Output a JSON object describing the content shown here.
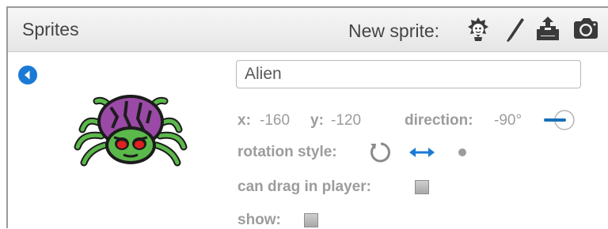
{
  "panel": {
    "title": "Sprites",
    "new_sprite_label": "New sprite:",
    "new_sprite_buttons": [
      "sprite-library-icon",
      "paint-brush-icon",
      "upload-icon",
      "camera-icon"
    ]
  },
  "sprite": {
    "name": "Alien",
    "x_label": "x:",
    "x_value": "-160",
    "y_label": "y:",
    "y_value": "-120",
    "direction_label": "direction:",
    "direction_value": "-90°",
    "rotation_style_label": "rotation style:",
    "rotation_options": [
      "rotate-all-around-icon",
      "left-right-icon",
      "dont-rotate-icon"
    ],
    "can_drag_label": "can drag in player:",
    "show_label": "show:"
  },
  "colors": {
    "accent_blue": "#1a7ad6",
    "label_gray": "#9c9c9c"
  }
}
